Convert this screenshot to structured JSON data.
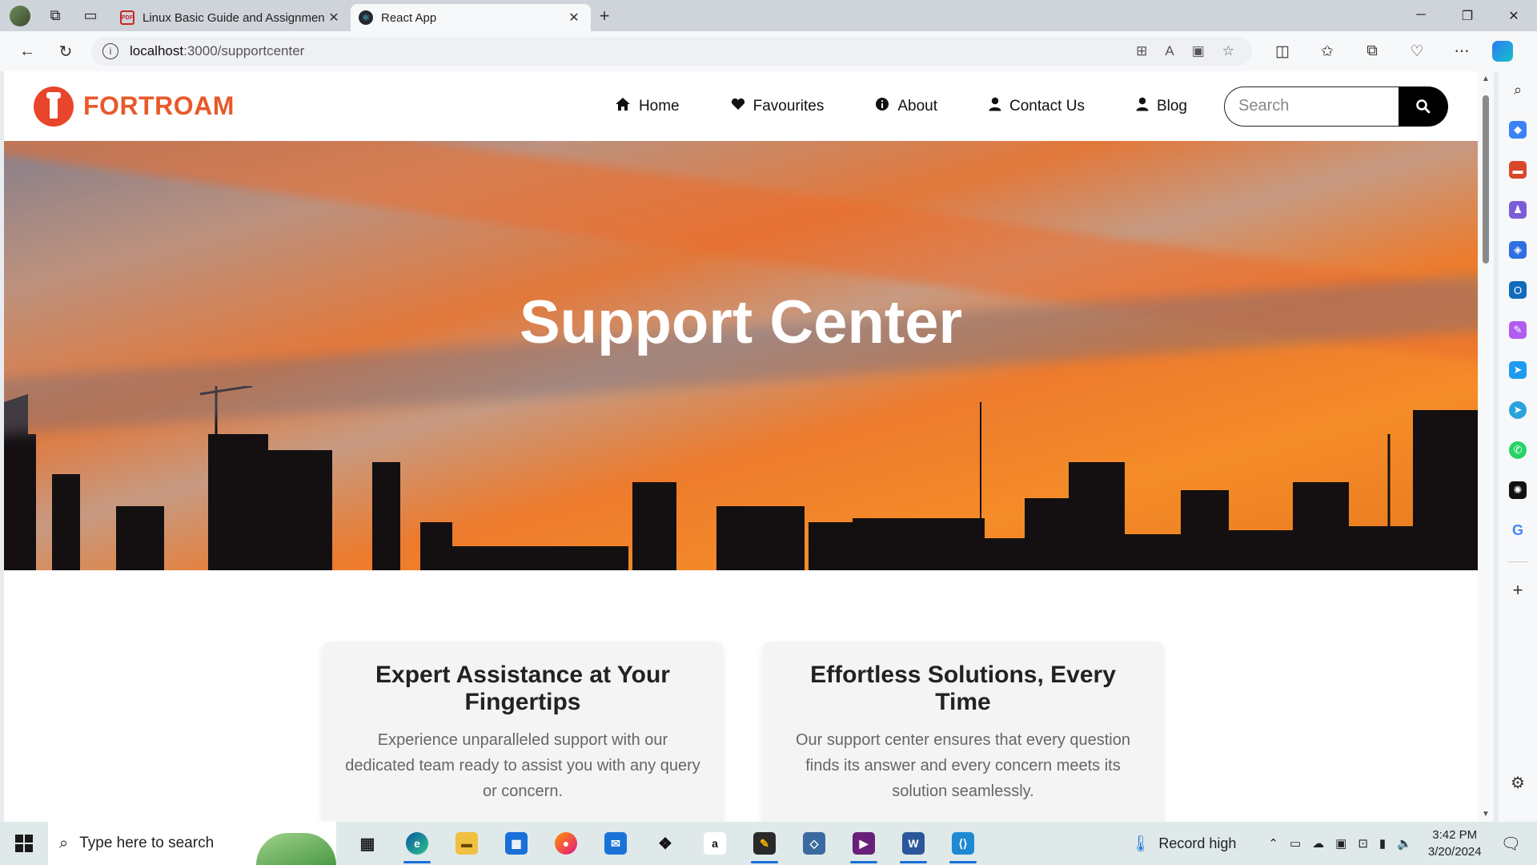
{
  "browser": {
    "tabs": [
      {
        "title": "Linux Basic Guide and Assignmen",
        "favicon": "pdf-icon",
        "active": false
      },
      {
        "title": "React App",
        "favicon": "react-icon",
        "active": true
      }
    ],
    "url_host": "localhost",
    "url_path": ":3000/supportcenter"
  },
  "site": {
    "brand": "FORTROAM",
    "brand_color": "#e85a2b",
    "nav": [
      {
        "label": "Home",
        "icon": "home-icon"
      },
      {
        "label": "Favourites",
        "icon": "heart-icon"
      },
      {
        "label": "About",
        "icon": "info-icon"
      },
      {
        "label": "Contact Us",
        "icon": "user-icon"
      },
      {
        "label": "Blog",
        "icon": "user-icon"
      }
    ],
    "search_placeholder": "Search"
  },
  "hero": {
    "title": "Support Center"
  },
  "cards": [
    {
      "title": "Expert Assistance at Your Fingertips",
      "text": "Experience unparalleled support with our dedicated team ready to assist you with any query or concern."
    },
    {
      "title": "Effortless Solutions, Every Time",
      "text": "Our support center ensures that every question finds its answer and every concern meets its solution seamlessly."
    }
  ],
  "taskbar": {
    "search_placeholder": "Type here to search",
    "weather": "Record high",
    "time": "3:42 PM",
    "date": "3/20/2024"
  }
}
